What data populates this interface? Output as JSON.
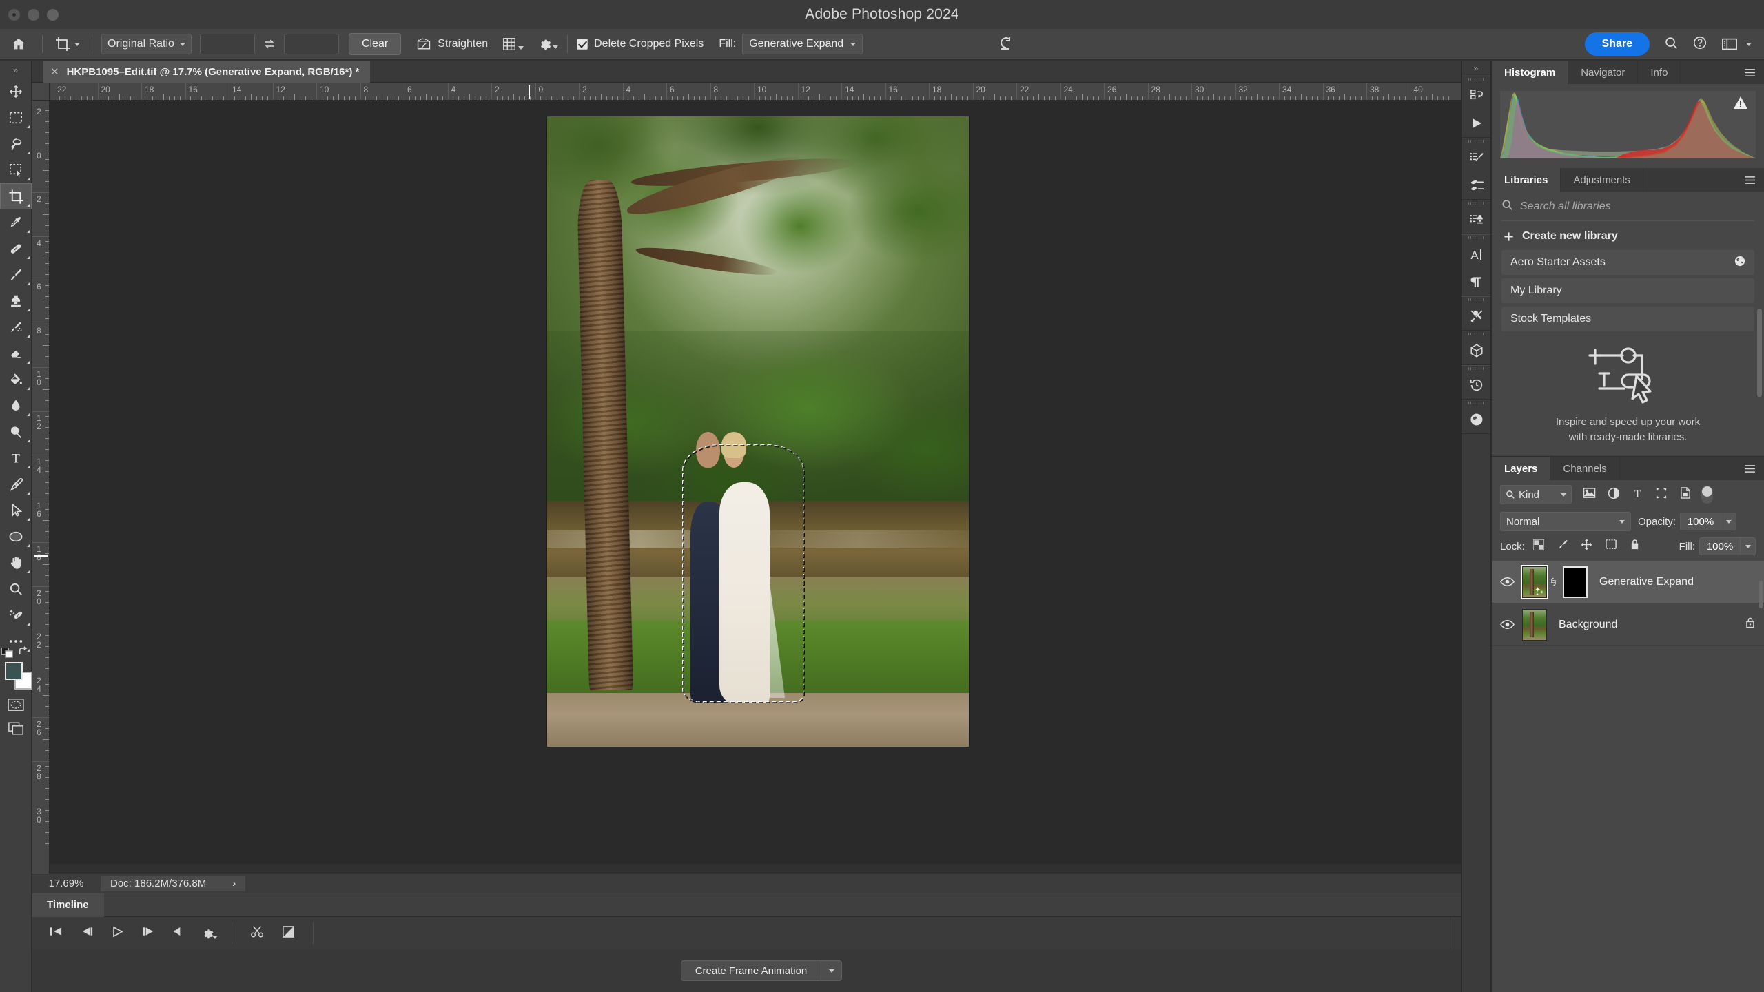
{
  "window": {
    "title": "Adobe Photoshop 2024"
  },
  "options_bar": {
    "home_icon": "home-icon",
    "tool_icon": "crop-tool-icon",
    "ratio_label": "Original Ratio",
    "width_value": "",
    "height_value": "",
    "width_placeholder": "",
    "height_placeholder": "",
    "swap_icon": "swap-arrows-icon",
    "clear_label": "Clear",
    "straighten_label": "Straighten",
    "straighten_icon": "straighten-icon",
    "overlay_icon": "crop-overlay-grid-icon",
    "settings_icon": "gear-icon",
    "delete_cropped_label": "Delete Cropped Pixels",
    "delete_cropped_checked": true,
    "fill_label": "Fill:",
    "fill_value": "Generative Expand",
    "reset_icon": "reset-icon",
    "share_label": "Share",
    "search_icon": "search-icon",
    "help_icon": "help-icon",
    "workspace_icon": "workspace-icon",
    "workspace_chevron": "chevron-down-icon",
    "accent_color": "#1473e6"
  },
  "toolbar": {
    "collapse_icon": "double-chevron-right-icon",
    "tools": [
      {
        "name": "move-tool",
        "icon": "move-icon",
        "selected": false,
        "has_flyout": false
      },
      {
        "name": "marquee-tool",
        "icon": "rectangular-marquee-icon",
        "selected": false,
        "has_flyout": true
      },
      {
        "name": "lasso-tool",
        "icon": "lasso-icon",
        "selected": false,
        "has_flyout": true
      },
      {
        "name": "object-selection-tool",
        "icon": "object-selection-icon",
        "selected": false,
        "has_flyout": true
      },
      {
        "name": "crop-tool",
        "icon": "crop-icon",
        "selected": true,
        "has_flyout": true
      },
      {
        "name": "eyedropper-tool",
        "icon": "eyedropper-icon",
        "selected": false,
        "has_flyout": true
      },
      {
        "name": "healing-brush-tool",
        "icon": "bandage-icon",
        "selected": false,
        "has_flyout": true
      },
      {
        "name": "brush-tool",
        "icon": "paintbrush-icon",
        "selected": false,
        "has_flyout": true
      },
      {
        "name": "clone-stamp-tool",
        "icon": "clone-stamp-icon",
        "selected": false,
        "has_flyout": true
      },
      {
        "name": "history-brush-tool",
        "icon": "history-brush-icon",
        "selected": false,
        "has_flyout": true
      },
      {
        "name": "eraser-tool",
        "icon": "eraser-icon",
        "selected": false,
        "has_flyout": true
      },
      {
        "name": "gradient-tool",
        "icon": "paint-bucket-icon",
        "selected": false,
        "has_flyout": true
      },
      {
        "name": "blur-tool",
        "icon": "water-drop-icon",
        "selected": false,
        "has_flyout": true
      },
      {
        "name": "dodge-tool",
        "icon": "dodge-icon",
        "selected": false,
        "has_flyout": true
      },
      {
        "name": "type-tool",
        "icon": "text-t-icon",
        "selected": false,
        "has_flyout": true
      },
      {
        "name": "pen-tool",
        "icon": "pen-nib-icon",
        "selected": false,
        "has_flyout": true
      },
      {
        "name": "path-selection-tool",
        "icon": "arrow-cursor-icon",
        "selected": false,
        "has_flyout": true
      },
      {
        "name": "shape-tool",
        "icon": "ellipse-icon",
        "selected": false,
        "has_flyout": true
      },
      {
        "name": "hand-tool",
        "icon": "hand-icon",
        "selected": false,
        "has_flyout": true
      },
      {
        "name": "zoom-tool",
        "icon": "magnifier-icon",
        "selected": false,
        "has_flyout": false
      },
      {
        "name": "spot-healing-tool",
        "icon": "spot-healing-icon",
        "selected": false,
        "has_flyout": true
      },
      {
        "name": "edit-toolbar",
        "icon": "ellipsis-icon",
        "selected": false,
        "has_flyout": true
      }
    ],
    "foreground_color": "#3a5352",
    "background_color": "#ffffff",
    "swap_colors_icon": "swap-colors-icon",
    "default_colors_icon": "default-colors-icon",
    "quick_mask_icon": "quick-mask-icon",
    "screen_mode_icon": "screen-mode-icon"
  },
  "document_tab": {
    "close_icon": "close-icon",
    "title": "HKPB1095–Edit.tif @ 17.7% (Generative Expand, RGB/16*) *"
  },
  "rulers": {
    "horizontal_labels": [
      "22",
      "20",
      "18",
      "16",
      "14",
      "12",
      "10",
      "8",
      "6",
      "4",
      "2",
      "0",
      "2",
      "4",
      "6",
      "8",
      "10",
      "12",
      "14",
      "16",
      "18",
      "20",
      "22",
      "24",
      "26",
      "28",
      "30",
      "32",
      "34",
      "36",
      "38",
      "40"
    ],
    "vertical_labels": [
      "2",
      "0",
      "2",
      "4",
      "6",
      "8",
      "10",
      "12",
      "14",
      "16",
      "18",
      "20",
      "22",
      "24",
      "26",
      "28",
      "30"
    ],
    "unit": "inches"
  },
  "status_bar": {
    "zoom": "17.69%",
    "doc_info": "Doc: 186.2M/376.8M",
    "expand_icon": "chevron-right-icon"
  },
  "timeline": {
    "tab_label": "Timeline",
    "menu_icon": "panel-menu-icon",
    "controls": [
      {
        "name": "go-to-first-frame-button",
        "icon": "skip-back-icon"
      },
      {
        "name": "previous-frame-button",
        "icon": "step-back-icon"
      },
      {
        "name": "play-button",
        "icon": "play-icon"
      },
      {
        "name": "next-frame-button",
        "icon": "step-forward-icon"
      },
      {
        "name": "audio-button",
        "icon": "speaker-icon"
      },
      {
        "name": "timeline-settings-button",
        "icon": "gear-icon"
      },
      {
        "name": "split-clip-button",
        "icon": "scissors-icon"
      },
      {
        "name": "transition-button",
        "icon": "transition-icon"
      }
    ],
    "create_button_label": "Create Frame Animation",
    "create_button_chevron": "chevron-down-icon"
  },
  "icon_rail": {
    "collapse_icon": "double-chevron-right-icon",
    "groups": [
      [
        {
          "name": "actions-panel-icon",
          "icon": "actions-icon"
        },
        {
          "name": "play-actions-icon",
          "icon": "play-icon"
        }
      ],
      [
        {
          "name": "brush-settings-icon",
          "icon": "brush-settings-icon"
        },
        {
          "name": "brushes-panel-icon",
          "icon": "brushes-icon"
        }
      ],
      [
        {
          "name": "clone-source-panel-icon",
          "icon": "clone-source-icon"
        }
      ],
      [
        {
          "name": "character-panel-icon",
          "icon": "character-a-icon"
        },
        {
          "name": "paragraph-panel-icon",
          "icon": "pilcrow-icon"
        }
      ],
      [
        {
          "name": "tool-presets-panel-icon",
          "icon": "tools-icon"
        }
      ],
      [
        {
          "name": "3d-panel-icon",
          "icon": "cube-icon"
        }
      ],
      [
        {
          "name": "history-panel-icon",
          "icon": "clock-back-icon"
        }
      ],
      [
        {
          "name": "adjustments-panel-icon",
          "icon": "half-circle-icon"
        }
      ]
    ]
  },
  "histogram_panel": {
    "tabs": [
      {
        "label": "Histogram",
        "active": true
      },
      {
        "label": "Navigator",
        "active": false
      },
      {
        "label": "Info",
        "active": false
      }
    ],
    "menu_icon": "panel-menu-icon",
    "warning_icon": "warning-triangle-icon"
  },
  "libraries_panel": {
    "tabs": [
      {
        "label": "Libraries",
        "active": true
      },
      {
        "label": "Adjustments",
        "active": false
      }
    ],
    "menu_icon": "panel-menu-icon",
    "search_icon": "search-icon",
    "search_placeholder": "Search all libraries",
    "create_label": "Create new library",
    "create_icon": "plus-icon",
    "items": [
      {
        "label": "Aero Starter Assets",
        "badge_icon": "globe-shared-icon"
      },
      {
        "label": "My Library",
        "badge_icon": ""
      },
      {
        "label": "Stock Templates",
        "badge_icon": ""
      }
    ],
    "illustration_icon": "libraries-illustration-icon",
    "caption_line1": "Inspire and speed up your work",
    "caption_line2": "with ready-made libraries.",
    "footer_cloud_icon": "cloud-icon",
    "footer_add_icon": "plus-dropdown-icon"
  },
  "layers_panel": {
    "tabs": [
      {
        "label": "Layers",
        "active": true
      },
      {
        "label": "Channels",
        "active": false
      }
    ],
    "menu_icon": "panel-menu-icon",
    "filter_icon": "search-icon",
    "filter_label": "Kind",
    "filter_chevron": "chevron-down-icon",
    "filter_buttons": [
      {
        "name": "filter-pixel-layers",
        "icon": "image-icon"
      },
      {
        "name": "filter-adjustment-layers",
        "icon": "half-circle-icon"
      },
      {
        "name": "filter-type-layers",
        "icon": "text-t-icon"
      },
      {
        "name": "filter-shape-layers",
        "icon": "shape-bounds-icon"
      },
      {
        "name": "filter-smart-objects",
        "icon": "smart-object-icon"
      }
    ],
    "filter_toggle": "filter-toggle-switch",
    "blend_mode": "Normal",
    "blend_chevron": "chevron-down-icon",
    "opacity_label": "Opacity:",
    "opacity_value": "100%",
    "lock_label": "Lock:",
    "lock_buttons": [
      {
        "name": "lock-transparent-pixels",
        "icon": "checkerboard-icon"
      },
      {
        "name": "lock-image-pixels",
        "icon": "paintbrush-icon"
      },
      {
        "name": "lock-position",
        "icon": "move-icon"
      },
      {
        "name": "lock-artboard-nesting",
        "icon": "artboard-icon"
      },
      {
        "name": "lock-all",
        "icon": "padlock-icon"
      }
    ],
    "fill_label": "Fill:",
    "fill_value": "100%",
    "layers": [
      {
        "name": "Generative Expand",
        "visible": true,
        "selected": true,
        "has_mask": true,
        "mask_color": "#000000",
        "linked": true,
        "locked": false,
        "generative_badge": "sparkles-icon"
      },
      {
        "name": "Background",
        "visible": true,
        "selected": false,
        "has_mask": false,
        "linked": false,
        "locked": true,
        "lock_icon": "padlock-icon"
      }
    ]
  },
  "canvas": {
    "image_description": "wedding-photo-couple-under-tree",
    "selection_marching_ants": true
  }
}
